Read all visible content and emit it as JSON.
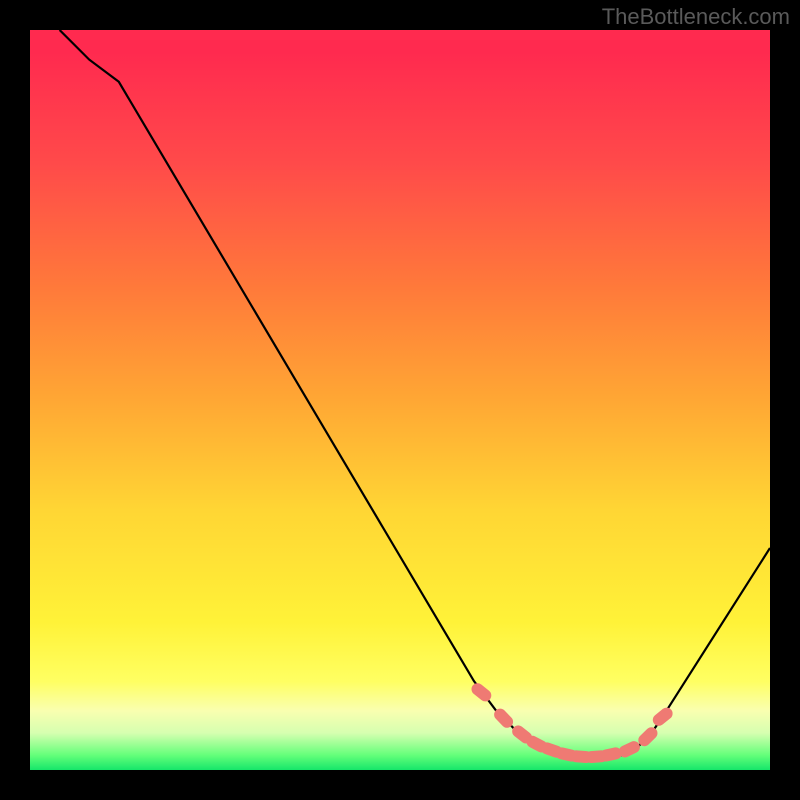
{
  "watermark": "TheBottleneck.com",
  "chart_data": {
    "type": "line",
    "title": "",
    "xlabel": "",
    "ylabel": "",
    "xlim": [
      0,
      100
    ],
    "ylim": [
      0,
      100
    ],
    "series": [
      {
        "name": "curve",
        "x": [
          4,
          8,
          12,
          60,
          63,
          66,
          68,
          70,
          72,
          74,
          76,
          78,
          80,
          82,
          84,
          86,
          100
        ],
        "y": [
          100,
          96,
          93,
          12,
          8,
          5,
          3.5,
          2.5,
          2,
          1.7,
          1.6,
          1.7,
          2,
          3,
          5,
          8,
          30
        ]
      }
    ],
    "markers": {
      "name": "highlighted-points",
      "x": [
        61,
        64,
        66.5,
        68.5,
        70.5,
        72.5,
        74.5,
        76.5,
        78.5,
        81,
        83.5,
        85.5
      ],
      "y": [
        10.5,
        7,
        4.8,
        3.5,
        2.7,
        2.1,
        1.8,
        1.8,
        2.1,
        2.8,
        4.5,
        7.2
      ]
    }
  }
}
